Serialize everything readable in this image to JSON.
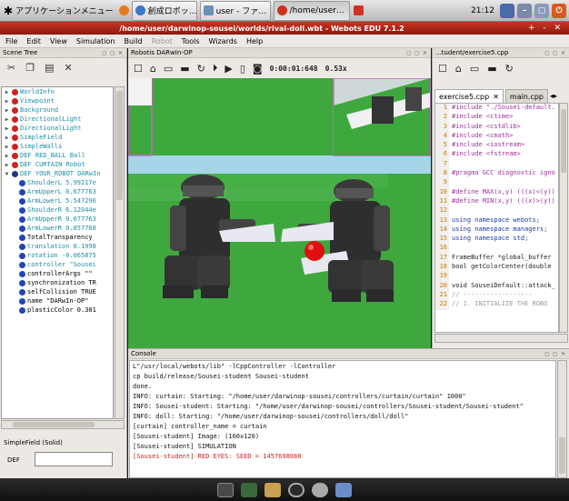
{
  "taskbar": {
    "apps_menu": "アプリケーションメニュー",
    "windows": [
      {
        "label": "創成ロボッ…",
        "color": "#3a78c8"
      },
      {
        "label": "user - ファ…",
        "color": "#6a8fb8"
      },
      {
        "label": "/home/user…",
        "color": "#cc3322"
      }
    ],
    "clock": "21:12"
  },
  "window": {
    "title": "/home/user/darwinop-sousei/worlds/rival-doll.wbt - Webots EDU 7.1.2",
    "controls": "+ - ✕"
  },
  "menu": [
    "File",
    "Edit",
    "View",
    "Simulation",
    "Build",
    "Robot",
    "Tools",
    "Wizards",
    "Help"
  ],
  "scene_tree": {
    "title": "Scene Tree",
    "nodes": [
      {
        "label": "WorldInfo",
        "color": "#d02020",
        "style": "teal",
        "arrow": "▶",
        "indent": 0
      },
      {
        "label": "Viewpoint",
        "color": "#d02020",
        "style": "teal",
        "arrow": "▶",
        "indent": 0
      },
      {
        "label": "Background",
        "color": "#d02020",
        "style": "teal",
        "arrow": "▶",
        "indent": 0
      },
      {
        "label": "DirectionalLight",
        "color": "#d02020",
        "style": "teal",
        "arrow": "▶",
        "indent": 0
      },
      {
        "label": "DirectionalLight",
        "color": "#d02020",
        "style": "teal",
        "arrow": "▶",
        "indent": 0
      },
      {
        "label": "SimpleField",
        "color": "#d02020",
        "style": "teal",
        "arrow": "▶",
        "indent": 0
      },
      {
        "label": "SimpleWalls",
        "color": "#d02020",
        "style": "teal",
        "arrow": "▶",
        "indent": 0
      },
      {
        "label": "DEF RED_BALL Ball",
        "color": "#d02020",
        "style": "teal",
        "arrow": "▶",
        "indent": 0
      },
      {
        "label": "DEF CURTAIN Robot",
        "color": "#d02020",
        "style": "teal",
        "arrow": "▶",
        "indent": 0
      },
      {
        "label": "DEF YOUR_ROBOT DARwIn",
        "color": "#223388",
        "style": "teal",
        "arrow": "▼",
        "indent": 0
      },
      {
        "label": "ShoulderL 5.99217e",
        "color": "#2244bb",
        "style": "teal",
        "arrow": "",
        "indent": 1
      },
      {
        "label": "ArmUpperL 0.677763",
        "color": "#2244bb",
        "style": "teal",
        "arrow": "",
        "indent": 1
      },
      {
        "label": "ArmLowerL 5.547296",
        "color": "#2244bb",
        "style": "teal",
        "arrow": "",
        "indent": 1
      },
      {
        "label": "ShoulderR 6.12944e",
        "color": "#2244bb",
        "style": "teal",
        "arrow": "",
        "indent": 1
      },
      {
        "label": "ArmUpperR 0.677763",
        "color": "#2244bb",
        "style": "teal",
        "arrow": "",
        "indent": 1
      },
      {
        "label": "ArmLowerR 0.857768",
        "color": "#2244bb",
        "style": "teal",
        "arrow": "",
        "indent": 1
      },
      {
        "label": "TotalTransparency",
        "color": "#2244bb",
        "style": "dark",
        "arrow": "",
        "indent": 1
      },
      {
        "label": "translation 0.1998",
        "color": "#2244bb",
        "style": "teal",
        "arrow": "",
        "indent": 1
      },
      {
        "label": "rotation -0.065875",
        "color": "#2244bb",
        "style": "teal",
        "arrow": "",
        "indent": 1
      },
      {
        "label": "controller \"Sousei",
        "color": "#2244bb",
        "style": "teal",
        "arrow": "",
        "indent": 1
      },
      {
        "label": "controllerArgs \"\"",
        "color": "#2244bb",
        "style": "dark",
        "arrow": "",
        "indent": 1
      },
      {
        "label": "synchronization TR",
        "color": "#2244bb",
        "style": "dark",
        "arrow": "",
        "indent": 1
      },
      {
        "label": "selfCollision TRUE",
        "color": "#2244bb",
        "style": "dark",
        "arrow": "",
        "indent": 1
      },
      {
        "label": "name \"DARwIn-OP\"",
        "color": "#2244bb",
        "style": "dark",
        "arrow": "",
        "indent": 1
      },
      {
        "label": "plasticColor 0.301",
        "color": "#2244bb",
        "style": "dark",
        "arrow": "",
        "indent": 1
      }
    ],
    "field_label": "SimpleField (Solid)",
    "def_label": "DEF",
    "def_value": ""
  },
  "view3d": {
    "title": "Robotis DARwIn-OP",
    "time": "0:00:01:648",
    "speed": "0.53x"
  },
  "editor": {
    "title": "...tudent/exercise5.cpp",
    "tabs": [
      "exercise5.cpp",
      "main.cpp"
    ],
    "lines": [
      {
        "n": "1",
        "t": "#include \"./Sousei-default."
      },
      {
        "n": "2",
        "t": "#include <ctime>"
      },
      {
        "n": "3",
        "t": "#include <cstdlib>"
      },
      {
        "n": "4",
        "t": "#include <cmath>"
      },
      {
        "n": "5",
        "t": "#include <iostream>"
      },
      {
        "n": "6",
        "t": "#include <fstream>"
      },
      {
        "n": "7",
        "t": ""
      },
      {
        "n": "8",
        "t": "#pragma GCC diagnostic igno"
      },
      {
        "n": "9",
        "t": ""
      },
      {
        "n": "10",
        "t": "#define MAX(x,y) (((x)<(y))"
      },
      {
        "n": "11",
        "t": "#define MIN(x,y) (((x)>(y))"
      },
      {
        "n": "12",
        "t": ""
      },
      {
        "n": "13",
        "t": "using namespace webots;"
      },
      {
        "n": "14",
        "t": "using namespace managers;"
      },
      {
        "n": "15",
        "t": "using namespace std;"
      },
      {
        "n": "16",
        "t": ""
      },
      {
        "n": "17",
        "t": "FrameBuffer *global_buffer"
      },
      {
        "n": "18",
        "t": "bool getColorCenter(double"
      },
      {
        "n": "19",
        "t": ""
      },
      {
        "n": "20",
        "t": "void SouseiDefault::attack_"
      },
      {
        "n": "21",
        "t": "  // ------------------"
      },
      {
        "n": "22",
        "t": "  // 1. INITIALIZE THE ROBO"
      }
    ]
  },
  "console": {
    "title": "Console",
    "lines": [
      {
        "t": "L\"/usr/local/webots/lib\" -lCppController -lController",
        "err": false
      },
      {
        "t": "cp build/release/Sousei-student Sousei-student",
        "err": false
      },
      {
        "t": "done.",
        "err": false
      },
      {
        "t": "INFO: curtain: Starting: \"/home/user/darwinop-sousei/controllers/curtain/curtain\" 1000\"",
        "err": false
      },
      {
        "t": "INFO: Sousei-student: Starting: \"/home/user/darwinop-sousei/controllers/Sousei-student/Sousei-student\"",
        "err": false
      },
      {
        "t": "INFO: doll: Starting: \"/home/user/darwinop-sousei/controllers/doll/doll\"",
        "err": false
      },
      {
        "t": "[curtain] controller_name = curtain",
        "err": false
      },
      {
        "t": "[Sousei-student] Image: (160x120)",
        "err": false
      },
      {
        "t": "[Sousei-student] SIMULATION",
        "err": false
      },
      {
        "t": "[Sousei-student] RED EYES: SEED = 1457698088",
        "err": true
      }
    ]
  },
  "colors": {
    "title_bar": "#cc3322",
    "floor": "#3ea83e",
    "sky": "#a7d5e8",
    "ball": "#e01010"
  }
}
